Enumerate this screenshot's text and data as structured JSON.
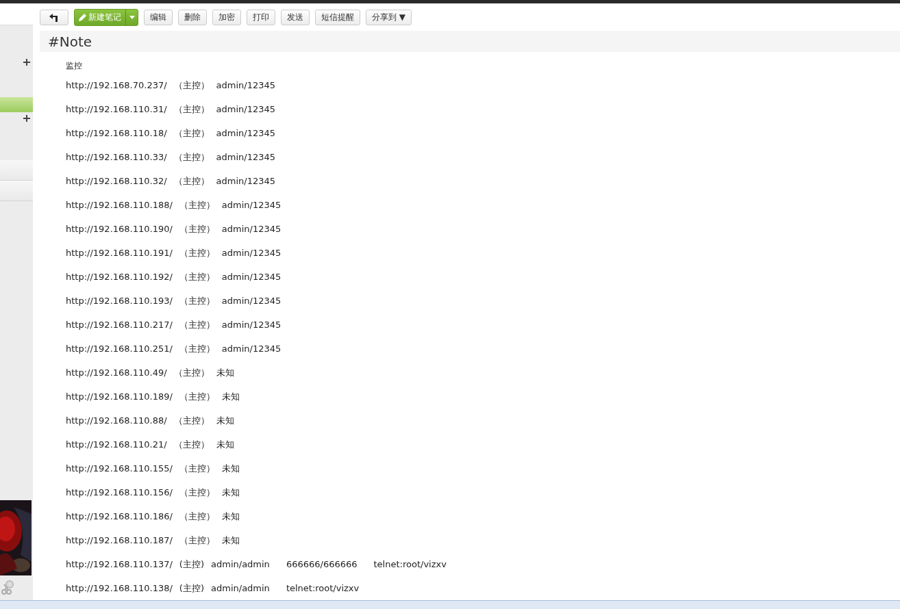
{
  "toolbar": {
    "new_note": "新建笔记",
    "buttons": [
      "编辑",
      "删除",
      "加密",
      "打印",
      "发送",
      "短信提醒"
    ],
    "share": {
      "label": "分享到",
      "caret": "▼"
    }
  },
  "note": {
    "title": "#Note",
    "heading": "监控",
    "lines": [
      [
        "http://192.168.70.237/",
        "（主控）",
        "admin/12345"
      ],
      [
        "http://192.168.110.31/",
        "（主控）",
        "admin/12345"
      ],
      [
        "http://192.168.110.18/",
        "（主控）",
        "admin/12345"
      ],
      [
        "http://192.168.110.33/",
        "（主控）",
        "admin/12345"
      ],
      [
        "http://192.168.110.32/",
        "（主控）",
        "admin/12345"
      ],
      [
        "http://192.168.110.188/",
        "（主控）",
        "admin/12345"
      ],
      [
        "http://192.168.110.190/",
        "（主控）",
        "admin/12345"
      ],
      [
        "http://192.168.110.191/",
        "（主控）",
        "admin/12345"
      ],
      [
        "http://192.168.110.192/",
        "（主控）",
        "admin/12345"
      ],
      [
        "http://192.168.110.193/",
        "（主控）",
        "admin/12345"
      ],
      [
        "http://192.168.110.217/",
        "（主控）",
        "admin/12345"
      ],
      [
        "http://192.168.110.251/",
        "（主控）",
        "admin/12345"
      ],
      [
        "http://192.168.110.49/",
        "（主控）",
        "未知"
      ],
      [
        "http://192.168.110.189/",
        "（主控）",
        "未知"
      ],
      [
        "http://192.168.110.88/",
        "（主控）",
        "未知"
      ],
      [
        "http://192.168.110.21/",
        "（主控）",
        "未知"
      ],
      [
        "http://192.168.110.155/",
        "（主控）",
        "未知"
      ],
      [
        "http://192.168.110.156/",
        "（主控）",
        "未知"
      ],
      [
        "http://192.168.110.186/",
        "（主控）",
        "未知"
      ],
      [
        "http://192.168.110.187/",
        "（主控）",
        "未知"
      ],
      [
        "http://192.168.110.137/",
        "(主控)",
        "admin/admin",
        "666666/666666",
        "telnet:root/vizxv"
      ],
      [
        "http://192.168.110.138/",
        "(主控)",
        "admin/admin",
        "telnet:root/vizxv"
      ]
    ]
  }
}
